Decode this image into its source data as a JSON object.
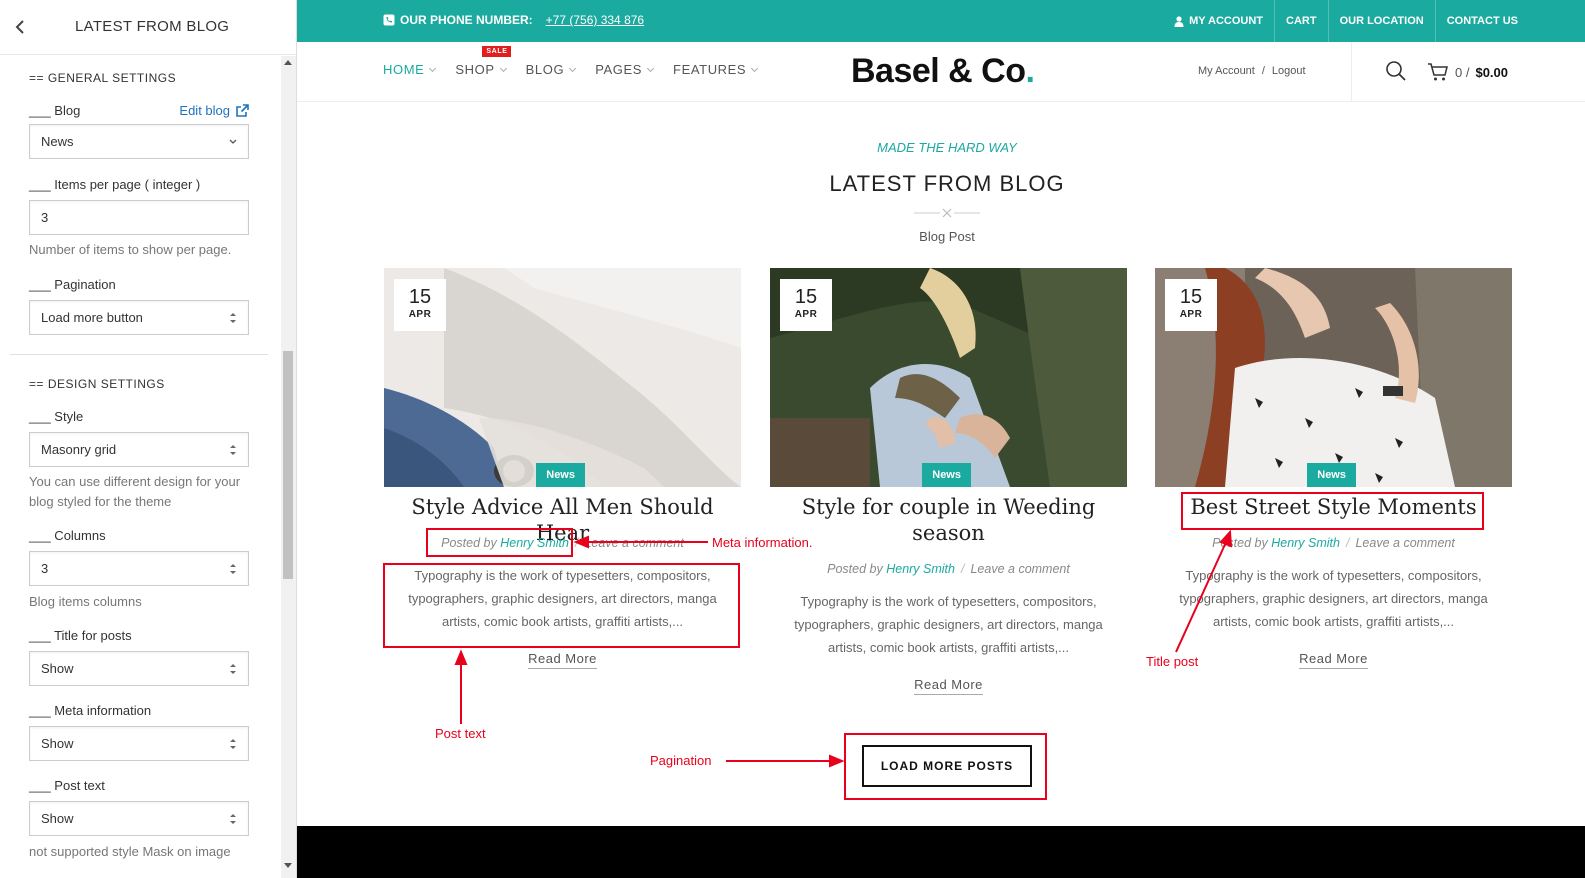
{
  "panel": {
    "title": "LATEST FROM BLOG",
    "general_settings": "== GENERAL SETTINGS",
    "design_settings": "== DESIGN SETTINGS",
    "blog_label": "___ Blog",
    "edit_blog": "Edit blog",
    "blog_value": "News",
    "items_label": "___ Items per page ( integer )",
    "items_value": "3",
    "items_note": "Number of items to show per page.",
    "pagination_label": "___ Pagination",
    "pagination_value": "Load more button",
    "style_label": "___ Style",
    "style_value": "Masonry grid",
    "style_note": "You can use different design for your blog styled for the theme",
    "columns_label": "___ Columns",
    "columns_value": "3",
    "columns_note": "Blog items columns",
    "title_posts_label": "___ Title for posts",
    "title_posts_value": "Show",
    "meta_label": "___ Meta information",
    "meta_value": "Show",
    "post_text_label": "___ Post text",
    "post_text_value": "Show",
    "mask_note": "not supported style Mask on image"
  },
  "topbar": {
    "phone_label": "OUR PHONE NUMBER:",
    "phone": "+77 (756) 334 876",
    "links": [
      "MY ACCOUNT",
      "CART",
      "OUR LOCATION",
      "CONTACT US"
    ],
    "color": "#1aaa9f"
  },
  "header": {
    "nav": [
      "HOME",
      "SHOP",
      "BLOG",
      "PAGES",
      "FEATURES"
    ],
    "sale_badge": "SALE",
    "logo": "Basel & Co",
    "logo_dot": ".",
    "my_account": "My Account",
    "slash": "/",
    "logout": "Logout",
    "cart_count": "0 /",
    "cart_total": "$0.00"
  },
  "section": {
    "eyebrow": "MADE THE HARD WAY",
    "title": "LATEST FROM BLOG",
    "subtitle": "Blog Post"
  },
  "posts": [
    {
      "day": "15",
      "month": "APR",
      "category": "News",
      "title": "Style Advice All Men Should Hear",
      "posted_by": "Posted by",
      "author": "Henry Smith",
      "comment": "Leave a comment",
      "excerpt": "Typography is the work of typesetters, compositors, typographers, graphic designers, art directors, manga artists, comic book artists, graffiti artists,...",
      "read_more": "Read More"
    },
    {
      "day": "15",
      "month": "APR",
      "category": "News",
      "title": "Style for couple in Weeding season",
      "posted_by": "Posted by",
      "author": "Henry Smith",
      "comment": "Leave a comment",
      "excerpt": "Typography is the work of typesetters, compositors, typographers, graphic designers, art directors, manga artists, comic book artists, graffiti artists,...",
      "read_more": "Read More"
    },
    {
      "day": "15",
      "month": "APR",
      "category": "News",
      "title": "Best Street Style Moments",
      "posted_by": "Posted by",
      "author": "Henry Smith",
      "comment": "Leave a comment",
      "excerpt": "Typography is the work of typesetters, compositors, typographers, graphic designers, art directors, manga artists, comic book artists, graffiti artists,...",
      "read_more": "Read More"
    }
  ],
  "load_more": "LOAD MORE POSTS",
  "annotations": {
    "meta": "Meta information.",
    "post_text": "Post text",
    "title_post": "Title post",
    "pagination": "Pagination",
    "color": "#e8001c"
  }
}
